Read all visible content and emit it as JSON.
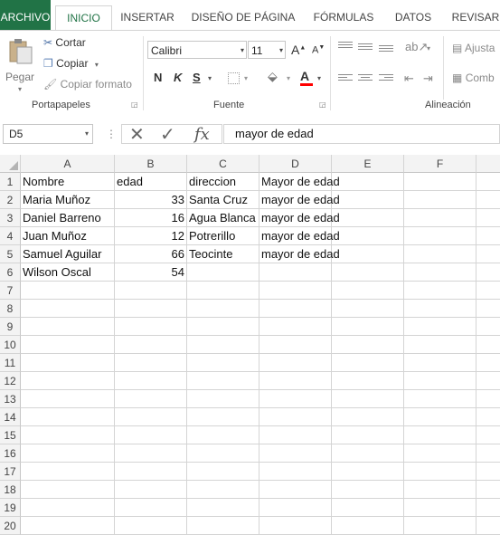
{
  "tabs": [
    {
      "label": "ARCHIVO"
    },
    {
      "label": "INICIO"
    },
    {
      "label": "INSERTAR"
    },
    {
      "label": "DISEÑO DE PÁGINA"
    },
    {
      "label": "FÓRMULAS"
    },
    {
      "label": "DATOS"
    },
    {
      "label": "REVISAR"
    }
  ],
  "clipboard": {
    "paste": "Pegar",
    "cut": "Cortar",
    "copy": "Copiar",
    "format_painter": "Copiar formato",
    "group": "Portapapeles"
  },
  "font": {
    "name": "Calibri",
    "size": "11",
    "bold": "N",
    "italic": "K",
    "underline": "S",
    "font_color_letter": "A",
    "grow": "A",
    "shrink": "A",
    "group": "Fuente"
  },
  "alignment": {
    "wrap": "Ajusta",
    "merge": "Comb",
    "group": "Alineación"
  },
  "formula_bar": {
    "name_box": "D5",
    "fx": "fx",
    "value": "mayor de edad"
  },
  "sheet": {
    "columns": [
      "A",
      "B",
      "C",
      "D",
      "E",
      "F"
    ],
    "rows": [
      "1",
      "2",
      "3",
      "4",
      "5",
      "6",
      "7",
      "8",
      "9",
      "10",
      "11",
      "12",
      "13",
      "14",
      "15",
      "16",
      "17",
      "18",
      "19",
      "20"
    ],
    "data": [
      [
        "Nombre",
        "edad",
        "direccion",
        "Mayor de edad"
      ],
      [
        "Maria Muñoz",
        "33",
        "Santa Cruz",
        "mayor de edad"
      ],
      [
        "Daniel Barreno",
        "16",
        "Agua Blanca",
        "mayor de edad"
      ],
      [
        "Juan Muñoz",
        "12",
        "Potrerillo",
        "mayor de edad"
      ],
      [
        "Samuel Aguilar",
        "66",
        "Teocinte",
        "mayor de edad"
      ],
      [
        "Wilson Oscal",
        "54",
        "",
        ""
      ]
    ]
  },
  "colors": {
    "file_tab": "#217346",
    "accent": "#217346",
    "font_color_bar": "#ff0000"
  }
}
